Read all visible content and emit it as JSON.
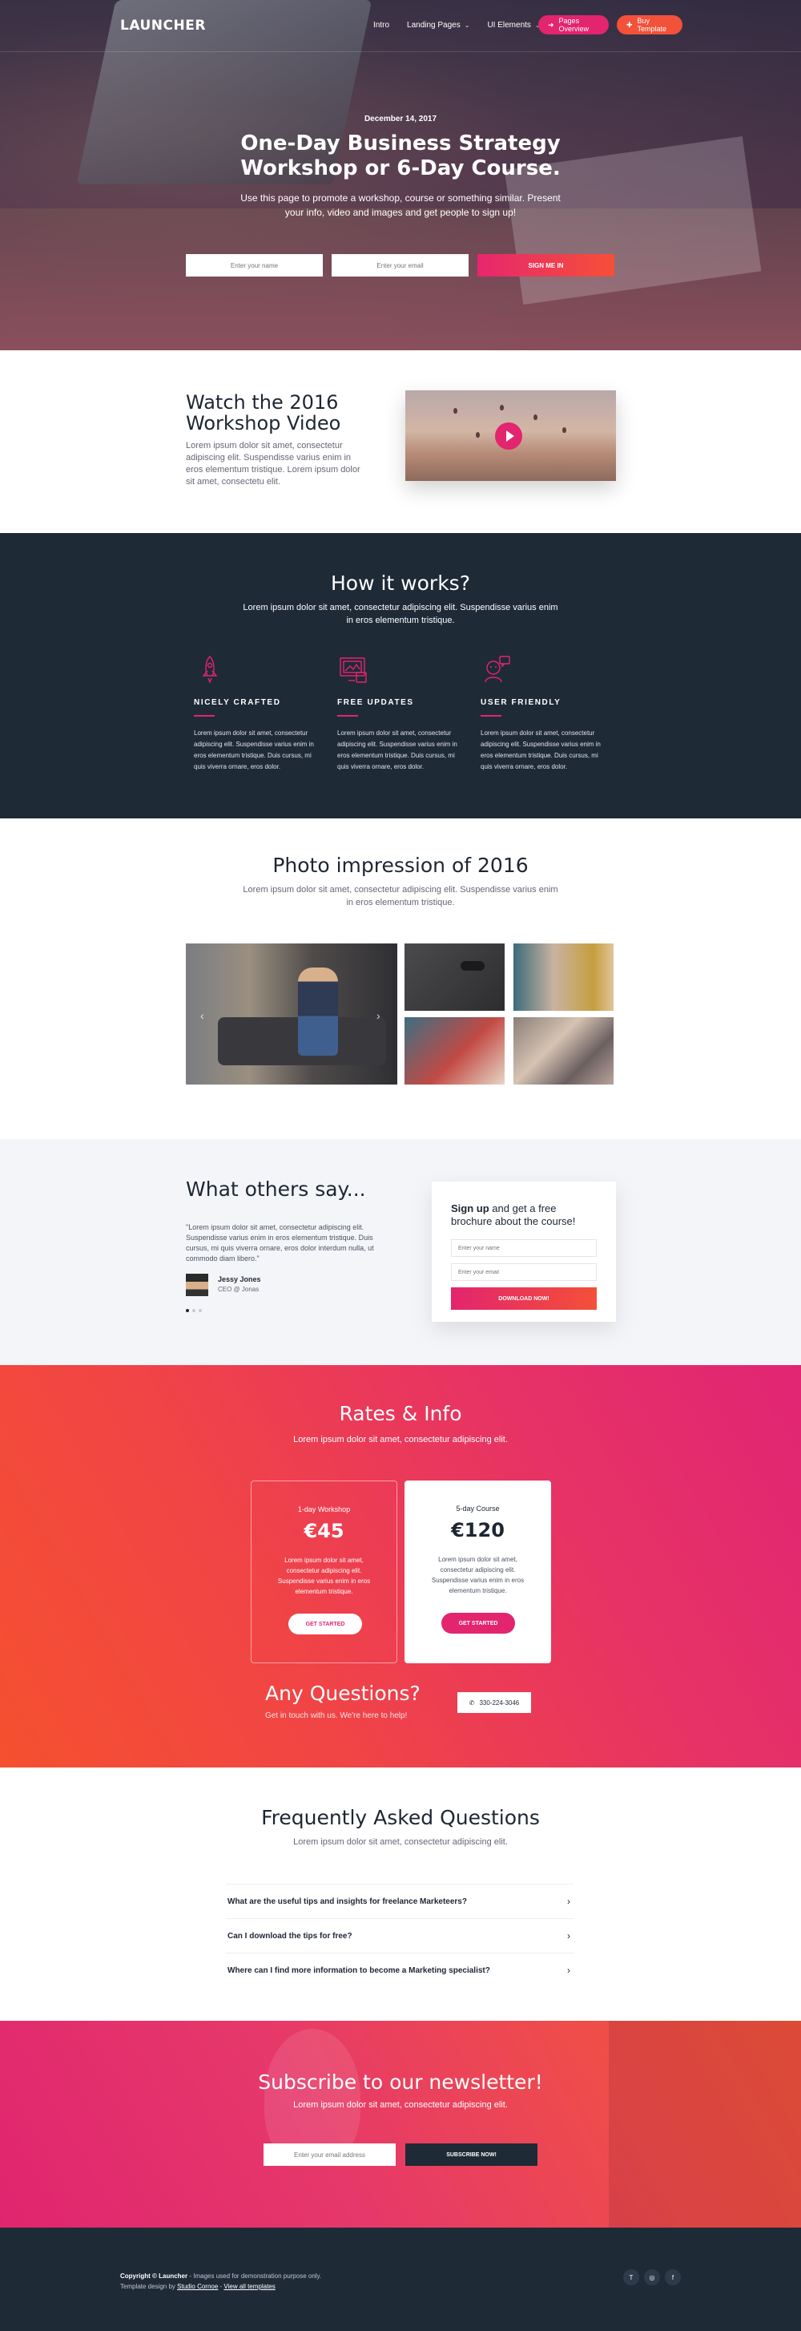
{
  "nav": {
    "logo": "LAUNCHER",
    "links": [
      {
        "label": "Intro",
        "dropdown": false
      },
      {
        "label": "Landing Pages",
        "dropdown": true
      },
      {
        "label": "UI Elements",
        "dropdown": true
      }
    ],
    "pages_overview": "Pages Overview",
    "buy_template": "Buy Template",
    "colors": {
      "pink": "#e3246f",
      "orange": "#f2513a"
    }
  },
  "hero": {
    "date": "December 14, 2017",
    "title_line1": "One-Day Business Strategy",
    "title_line2": "Workshop or 6-Day Course.",
    "subtitle_line1": "Use this page to promote a workshop, course or something similar. Present",
    "subtitle_line2": "your info, video and images and get people to sign up!",
    "name_placeholder": "Enter your name",
    "email_placeholder": "Enter your email",
    "submit": "SIGN ME IN"
  },
  "video": {
    "title": "Watch the 2016 Workshop Video",
    "text": "Lorem ipsum dolor sit amet, consectetur adipiscing elit. Suspendisse varius enim in eros elementum tristique. Lorem ipsum dolor sit amet, consectetu elit."
  },
  "how": {
    "title": "How it works?",
    "subtitle": "Lorem ipsum dolor sit amet, consectetur adipiscing elit. Suspendisse varius enim in eros elementum tristique.",
    "features": [
      {
        "icon": "rocket-icon",
        "title": "NICELY CRAFTED",
        "text": "Lorem ipsum dolor sit amet, consectetur adipiscing elit. Suspendisse varius enim in eros elementum tristique. Duis cursus, mi quis viverra ornare, eros dolor."
      },
      {
        "icon": "devices-icon",
        "title": "FREE UPDATES",
        "text": "Lorem ipsum dolor sit amet, consectetur adipiscing elit. Suspendisse varius enim in eros elementum tristique. Duis cursus, mi quis viverra ornare, eros dolor."
      },
      {
        "icon": "user-chat-icon",
        "title": "USER FRIENDLY",
        "text": "Lorem ipsum dolor sit amet, consectetur adipiscing elit. Suspendisse varius enim in eros elementum tristique. Duis cursus, mi quis viverra ornare, eros dolor."
      }
    ]
  },
  "photos": {
    "title": "Photo impression of 2016",
    "subtitle": "Lorem ipsum dolor sit amet, consectetur adipiscing elit. Suspendisse varius enim in eros elementum tristique."
  },
  "testimonial": {
    "title": "What others say...",
    "quote": "\"Lorem ipsum dolor sit amet, consectetur adipiscing elit. Suspendisse varius enim in eros elementum tristique. Duis cursus, mi quis viverra ornare, eros dolor interdum nulla, ut commodo diam libero.\"",
    "name": "Jessy Jones",
    "role": "CEO @ Jonas"
  },
  "signup": {
    "title_bold": "Sign up",
    "title_rest": " and get a free brochure about the course!",
    "name_placeholder": "Enter your name",
    "email_placeholder": "Enter your email",
    "button": "DOWNLOAD NOW!"
  },
  "rates": {
    "title": "Rates & Info",
    "subtitle": "Lorem ipsum dolor sit amet, consectetur adipiscing elit.",
    "cards": [
      {
        "title": "1-day Workshop",
        "price": "€45",
        "text": "Lorem ipsum dolor sit amet, consectetur adipiscing elit. Suspendisse varius enim in eros elementum tristique.",
        "button": "GET STARTED"
      },
      {
        "title": "5-day Course",
        "price": "€120",
        "text": "Lorem ipsum dolor sit amet, consectetur adipiscing elit. Suspendisse varius enim in eros elementum tristique.",
        "button": "GET STARTED"
      }
    ],
    "questions_title": "Any Questions?",
    "questions_sub": "Get in touch with us. We're here to help!",
    "phone": "330-224-3046"
  },
  "faq": {
    "title": "Frequently Asked Questions",
    "subtitle": "Lorem ipsum dolor sit amet, consectetur adipiscing elit.",
    "items": [
      "What are the useful tips and insights for freelance Marketeers?",
      "Can I download the tips for free?",
      "Where can I find more information to become a Marketing specialist?"
    ]
  },
  "newsletter": {
    "title": "Subscribe to our newsletter!",
    "subtitle": "Lorem ipsum dolor sit amet, consectetur adipiscing elit.",
    "email_placeholder": "Enter your email address",
    "button": "SUBSCRIBE NOW!"
  },
  "footer": {
    "copyright": "Copyright © Launcher",
    "copyright_rest": " - Images used for demonstration purpose only.",
    "design_prefix": "Template design by ",
    "design_link": "Studio Cornoe",
    "design_sep": " - ",
    "view_all": "View all templates",
    "social": [
      "T",
      "◎",
      "f"
    ]
  }
}
